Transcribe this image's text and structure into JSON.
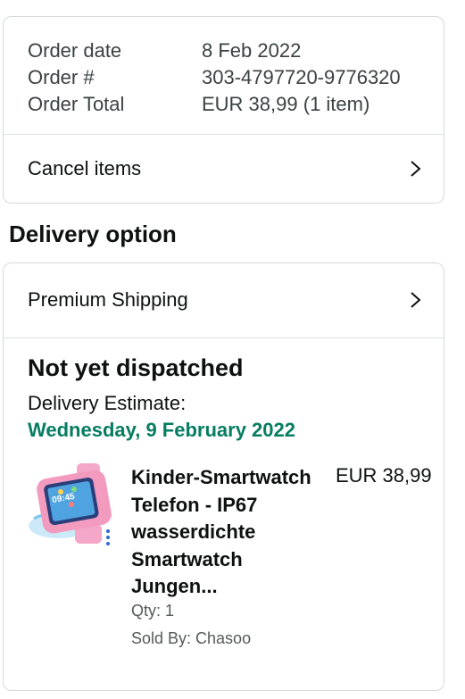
{
  "order": {
    "rows": [
      {
        "label": "Order date",
        "value": "8 Feb 2022"
      },
      {
        "label": "Order #",
        "value": "303-4797720-9776320"
      },
      {
        "label": "Order Total",
        "value": "EUR 38,99",
        "value_suffix": "(1 item)"
      }
    ],
    "cancel_label": "Cancel items"
  },
  "delivery": {
    "heading": "Delivery option",
    "shipping_label": "Premium Shipping",
    "status": "Not yet dispatched",
    "estimate_label": "Delivery Estimate:",
    "estimate_date": "Wednesday, 9 February 2022",
    "estimate_color": "#067d62"
  },
  "product": {
    "title": "Kinder-Smartwatch Telefon - IP67 wasserdichte Smartwatch Jungen...",
    "price": "EUR 38,99",
    "qty": "Qty: 1",
    "seller": "Sold By: Chasoo",
    "image_icon": "pink-kids-smartwatch-image",
    "screen_time": "09:45"
  },
  "icons": {
    "chevron": "chevron-right-icon"
  }
}
